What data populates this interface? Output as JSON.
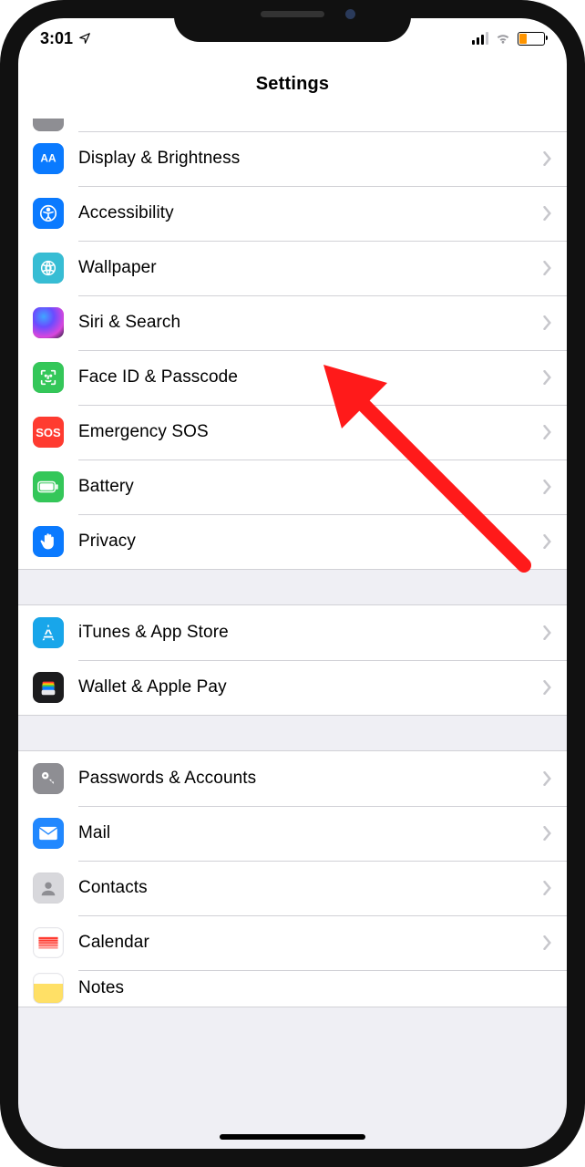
{
  "status": {
    "time": "3:01"
  },
  "nav": {
    "title": "Settings"
  },
  "groups": [
    {
      "rows": [
        {
          "key": "display",
          "label": "Display & Brightness",
          "icon": "display-brightness-icon"
        },
        {
          "key": "access",
          "label": "Accessibility",
          "icon": "accessibility-icon"
        },
        {
          "key": "wallpaper",
          "label": "Wallpaper",
          "icon": "wallpaper-icon"
        },
        {
          "key": "siri",
          "label": "Siri & Search",
          "icon": "siri-icon"
        },
        {
          "key": "faceid",
          "label": "Face ID & Passcode",
          "icon": "face-id-icon"
        },
        {
          "key": "sos",
          "label": "Emergency SOS",
          "icon": "sos-icon",
          "glyphText": "SOS"
        },
        {
          "key": "battery",
          "label": "Battery",
          "icon": "battery-icon"
        },
        {
          "key": "privacy",
          "label": "Privacy",
          "icon": "privacy-hand-icon"
        }
      ]
    },
    {
      "rows": [
        {
          "key": "itunes",
          "label": "iTunes & App Store",
          "icon": "app-store-icon"
        },
        {
          "key": "wallet",
          "label": "Wallet & Apple Pay",
          "icon": "wallet-icon"
        }
      ]
    },
    {
      "rows": [
        {
          "key": "passwords",
          "label": "Passwords & Accounts",
          "icon": "key-icon"
        },
        {
          "key": "mail",
          "label": "Mail",
          "icon": "mail-icon"
        },
        {
          "key": "contacts",
          "label": "Contacts",
          "icon": "contacts-icon"
        },
        {
          "key": "calendar",
          "label": "Calendar",
          "icon": "calendar-icon"
        },
        {
          "key": "notes",
          "label": "Notes",
          "icon": "notes-icon"
        }
      ]
    }
  ],
  "annotation": {
    "target": "faceid",
    "color": "#ff1a1a"
  }
}
